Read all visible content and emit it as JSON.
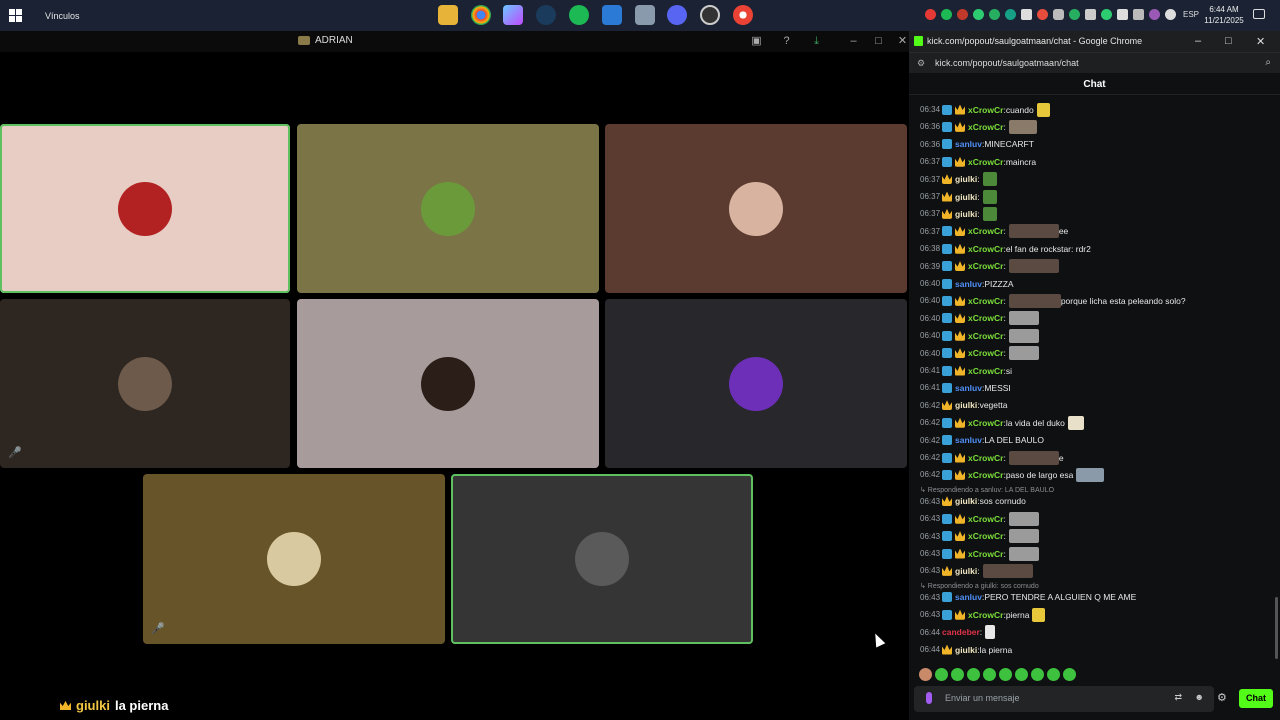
{
  "taskbar": {
    "links_label": "Vínculos",
    "lang": "ESP",
    "time": "6:44 AM",
    "date": "11/21/2025"
  },
  "discord": {
    "channel_title": "ADRIAN",
    "caption_user": "giulki",
    "caption_text": "la pierna",
    "tiles": [
      {
        "bg": "#e8cdc5",
        "avatar": "#b22222"
      },
      {
        "bg": "#7a7446",
        "avatar": "#6b9a3a"
      },
      {
        "bg": "#5b3b2f",
        "avatar": "#d8b4a0"
      },
      {
        "bg": "#2d2621",
        "avatar": "#6d5a4b"
      },
      {
        "bg": "#a79b9b",
        "avatar": "#2b1d18"
      },
      {
        "bg": "#27272c",
        "avatar": "#6d2fb8"
      },
      {
        "bg": "#675428",
        "avatar": "#d8c9a0"
      },
      {
        "bg": "#353535",
        "avatar": "#5a5a5a"
      }
    ]
  },
  "chrome": {
    "window_title": "kick.com/popout/saulgoatmaan/chat - Google Chrome",
    "url": "kick.com/popout/saulgoatmaan/chat",
    "chat_header": "Chat",
    "input_placeholder": "Enviar un mensaje",
    "send_label": "Chat"
  },
  "messages": [
    {
      "ts": "06:34",
      "user": "xCrowCr",
      "cls": "x",
      "badges": [
        "mod",
        "vip"
      ],
      "text": "cuando",
      "emote": "#e7c83a",
      "ew": 13
    },
    {
      "ts": "06:36",
      "user": "xCrowCr",
      "cls": "x",
      "badges": [
        "mod",
        "vip"
      ],
      "text": "",
      "emote": "#8a7a6a",
      "ew": 28
    },
    {
      "ts": "06:36",
      "user": "sanluv",
      "cls": "s",
      "badges": [
        "mod"
      ],
      "text": "MINECARFT"
    },
    {
      "ts": "06:37",
      "user": "xCrowCr",
      "cls": "x",
      "badges": [
        "mod",
        "vip"
      ],
      "text": "maincra"
    },
    {
      "ts": "06:37",
      "user": "giulki",
      "cls": "g",
      "badges": [
        "vip"
      ],
      "text": "",
      "emote": "#4c8a3a",
      "ew": 14
    },
    {
      "ts": "06:37",
      "user": "giulki",
      "cls": "g",
      "badges": [
        "vip"
      ],
      "text": "",
      "emote": "#4c8a3a",
      "ew": 14
    },
    {
      "ts": "06:37",
      "user": "giulki",
      "cls": "g",
      "badges": [
        "vip"
      ],
      "text": "",
      "emote": "#4c8a3a",
      "ew": 14
    },
    {
      "ts": "06:37",
      "user": "xCrowCr",
      "cls": "x",
      "badges": [
        "mod",
        "vip"
      ],
      "text": "",
      "emote": "#5a4a42",
      "ew": 50,
      "after": "ee"
    },
    {
      "ts": "06:38",
      "user": "xCrowCr",
      "cls": "x",
      "badges": [
        "mod",
        "vip"
      ],
      "text": "el fan de rockstar: rdr2"
    },
    {
      "ts": "06:39",
      "user": "xCrowCr",
      "cls": "x",
      "badges": [
        "mod",
        "vip"
      ],
      "text": "",
      "emote": "#5a4a42",
      "ew": 50
    },
    {
      "ts": "06:40",
      "user": "sanluv",
      "cls": "s",
      "badges": [
        "mod"
      ],
      "text": "PIZZZA"
    },
    {
      "ts": "06:40",
      "user": "xCrowCr",
      "cls": "x",
      "badges": [
        "mod",
        "vip"
      ],
      "text": "",
      "emote": "#5a4a42",
      "ew": 52,
      "after": "porque licha esta peleando solo?"
    },
    {
      "ts": "06:40",
      "user": "xCrowCr",
      "cls": "x",
      "badges": [
        "mod",
        "vip"
      ],
      "text": "",
      "emote": "#9b9b9b",
      "ew": 30
    },
    {
      "ts": "06:40",
      "user": "xCrowCr",
      "cls": "x",
      "badges": [
        "mod",
        "vip"
      ],
      "text": "",
      "emote": "#9b9b9b",
      "ew": 30
    },
    {
      "ts": "06:40",
      "user": "xCrowCr",
      "cls": "x",
      "badges": [
        "mod",
        "vip"
      ],
      "text": "",
      "emote": "#9b9b9b",
      "ew": 30
    },
    {
      "ts": "06:41",
      "user": "xCrowCr",
      "cls": "x",
      "badges": [
        "mod",
        "vip"
      ],
      "text": "si"
    },
    {
      "ts": "06:41",
      "user": "sanluv",
      "cls": "s",
      "badges": [
        "mod"
      ],
      "text": "MESSI"
    },
    {
      "ts": "06:42",
      "user": "giulki",
      "cls": "g",
      "badges": [
        "vip"
      ],
      "text": "vegetta"
    },
    {
      "ts": "06:42",
      "user": "xCrowCr",
      "cls": "x",
      "badges": [
        "mod",
        "vip"
      ],
      "text": "la vida del duko",
      "emote": "#e8e0c8",
      "ew": 16
    },
    {
      "ts": "06:42",
      "user": "sanluv",
      "cls": "s",
      "badges": [
        "mod"
      ],
      "text": "LA DEL BAULO"
    },
    {
      "ts": "06:42",
      "user": "xCrowCr",
      "cls": "x",
      "badges": [
        "mod",
        "vip"
      ],
      "text": "",
      "emote": "#5a4a42",
      "ew": 50,
      "after": "e"
    },
    {
      "ts": "06:42",
      "user": "xCrowCr",
      "cls": "x",
      "badges": [
        "mod",
        "vip"
      ],
      "text": "paso de largo esa",
      "emote": "#8a9aa8",
      "ew": 28
    },
    {
      "reply": "Respondiendo a sanluv: LA DEL BAULO"
    },
    {
      "ts": "06:43",
      "user": "giulki",
      "cls": "g",
      "badges": [
        "vip"
      ],
      "text": "sos cornudo"
    },
    {
      "ts": "06:43",
      "user": "xCrowCr",
      "cls": "x",
      "badges": [
        "mod",
        "vip"
      ],
      "text": "",
      "emote": "#9b9b9b",
      "ew": 30
    },
    {
      "ts": "06:43",
      "user": "xCrowCr",
      "cls": "x",
      "badges": [
        "mod",
        "vip"
      ],
      "text": "",
      "emote": "#9b9b9b",
      "ew": 30
    },
    {
      "ts": "06:43",
      "user": "xCrowCr",
      "cls": "x",
      "badges": [
        "mod",
        "vip"
      ],
      "text": "",
      "emote": "#9b9b9b",
      "ew": 30
    },
    {
      "ts": "06:43",
      "user": "giulki",
      "cls": "g",
      "badges": [
        "vip"
      ],
      "text": "",
      "emote": "#5a4a42",
      "ew": 50
    },
    {
      "reply": "Respondiendo a giulki: sos cornudo"
    },
    {
      "ts": "06:43",
      "user": "sanluv",
      "cls": "s",
      "badges": [
        "mod"
      ],
      "text": "PERO TENDRE A ALGUIEN Q ME AME"
    },
    {
      "ts": "06:43",
      "user": "xCrowCr",
      "cls": "x",
      "badges": [
        "mod",
        "vip"
      ],
      "text": "pierna",
      "emote": "#e7c83a",
      "ew": 13
    },
    {
      "ts": "06:44",
      "user": "candeber",
      "cls": "c",
      "badges": [],
      "text": "",
      "emote": "#e8e8e8",
      "ew": 10
    },
    {
      "ts": "06:44",
      "user": "giulki",
      "cls": "g",
      "badges": [
        "vip"
      ],
      "text": "la pierna"
    }
  ]
}
